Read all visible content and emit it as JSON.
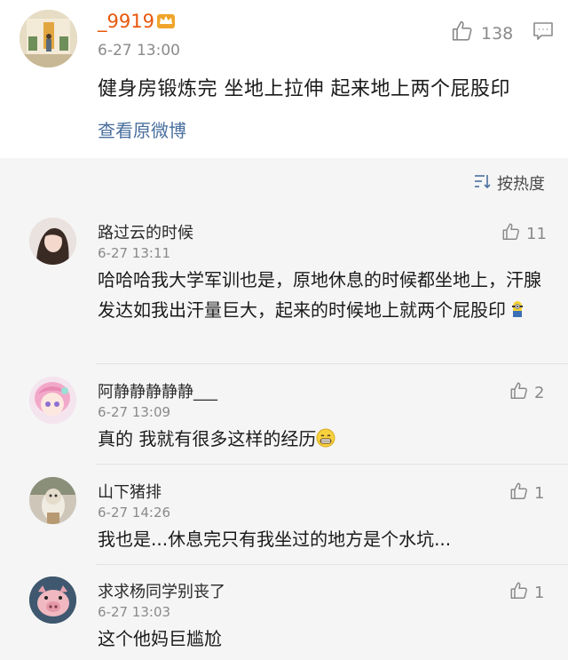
{
  "top_post": {
    "username": "_9919",
    "time": "6-27 13:00",
    "likes": "138",
    "text": "健身房锻炼完 坐地上拉伸 起来地上两个屁股印",
    "view_original": "查看原微博"
  },
  "sort_label": "按热度",
  "comments": [
    {
      "username": "路过云的时候",
      "time": "6-27 13:11",
      "likes": "11",
      "text": "哈哈哈我大学军训也是，原地休息的时候都坐地上，汗腺发达如我出汗量巨大，起来的时候地上就两个屁股印"
    },
    {
      "username": "阿静静静静静___",
      "time": "6-27 13:09",
      "likes": "2",
      "text": "真的 我就有很多这样的经历"
    },
    {
      "username": "山下猪排",
      "time": "6-27 14:26",
      "likes": "1",
      "text": "我也是...休息完只有我坐过的地方是个水坑..."
    },
    {
      "username": "求求杨同学别丧了",
      "time": "6-27 13:03",
      "likes": "1",
      "text": "这个他妈巨尴尬"
    }
  ]
}
